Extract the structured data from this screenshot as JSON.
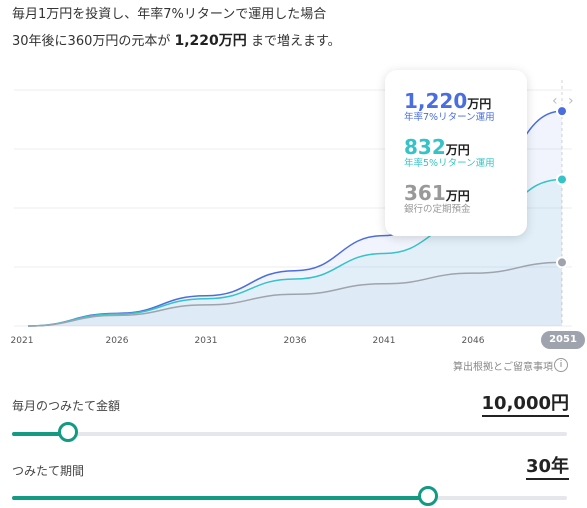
{
  "intro": {
    "line1": "毎月1万円を投資し、年率7%リターンで運用した場合",
    "line2_prefix": "30年後に360万円の元本が",
    "line2_amount": "1,220万円",
    "line2_suffix": "まで増えます。"
  },
  "tooltip": {
    "items": [
      {
        "value": "1,220",
        "unit": "万円",
        "label": "年率7%リターン運用"
      },
      {
        "value": "832",
        "unit": "万円",
        "label": "年率5%リターン運用"
      },
      {
        "value": "361",
        "unit": "万円",
        "label": "銀行の定期預金"
      }
    ]
  },
  "chart_data": {
    "type": "area",
    "x_ticks": [
      "2021",
      "2026",
      "2031",
      "2036",
      "2041",
      "2046",
      "2051"
    ],
    "x_range": [
      2021,
      2051
    ],
    "ylim": [
      0,
      1340
    ],
    "series": [
      {
        "name": "年率7%リターン運用",
        "color": "#4a6de0",
        "x": [
          2021,
          2026,
          2031,
          2036,
          2041,
          2046,
          2051
        ],
        "values": [
          0,
          72,
          172,
          314,
          513,
          794,
          1220
        ]
      },
      {
        "name": "年率5%リターン運用",
        "color": "#35c3c8",
        "x": [
          2021,
          2026,
          2031,
          2036,
          2041,
          2046,
          2051
        ],
        "values": [
          0,
          68,
          155,
          267,
          412,
          598,
          832
        ]
      },
      {
        "name": "銀行の定期預金",
        "color": "#9fa3ad",
        "x": [
          2021,
          2026,
          2031,
          2036,
          2041,
          2046,
          2051
        ],
        "values": [
          0,
          60,
          120,
          180,
          240,
          300,
          361
        ]
      }
    ],
    "grid": true
  },
  "end_badge": "2051",
  "note": "算出根拠とご留意事項",
  "info_icon": "i",
  "nav_arrows": "‹ ›",
  "monthly": {
    "label": "毎月のつみたて金額",
    "value": "10,000円",
    "fraction": 0.1
  },
  "period": {
    "label": "つみたて期間",
    "value": "30年",
    "fraction": 0.75
  },
  "colors": {
    "accent": "#139a82"
  }
}
